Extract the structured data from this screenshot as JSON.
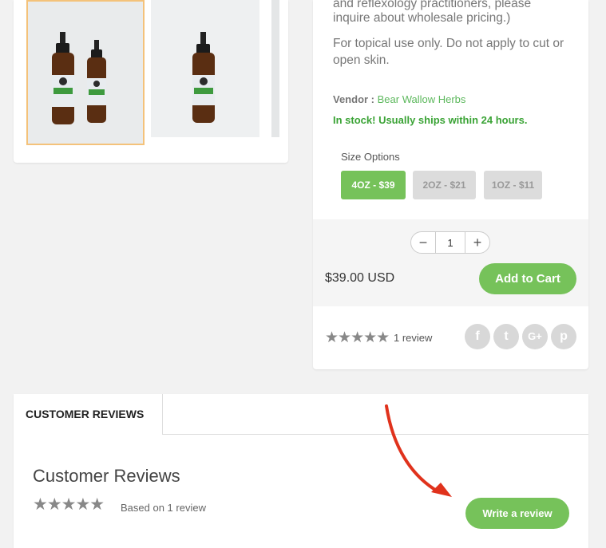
{
  "description": {
    "line1": "and reflexology practitioners, please",
    "line2": "inquire about wholesale pricing.)",
    "topical_line1": "For topical use only. Do not apply to cut or",
    "topical_line2": "open skin."
  },
  "vendor": {
    "label": "Vendor :",
    "name": "Bear Wallow Herbs"
  },
  "stock_text": "In stock! Usually ships within 24 hours.",
  "size_options": {
    "label": "Size Options",
    "options": [
      "4OZ - $39",
      "2OZ - $21",
      "1OZ - $11"
    ],
    "selected": "4OZ - $39"
  },
  "quantity": {
    "minus": "−",
    "value": "1",
    "plus": "+"
  },
  "price": "$39.00 USD",
  "add_to_cart": "Add to Cart",
  "rating": {
    "stars": "★★★★★",
    "count_text": "1 review"
  },
  "social": {
    "facebook": "f",
    "twitter": "t",
    "googleplus": "G+",
    "pinterest": "p"
  },
  "reviews": {
    "tab_label": "CUSTOMER REVIEWS",
    "title": "Customer Reviews",
    "stars": "★★★★★",
    "based_on": "Based on 1 review",
    "write_button": "Write a review"
  },
  "colors": {
    "accent_green": "#76c25a",
    "stock_green": "#3aa335",
    "vendor_link": "#5cb85c",
    "arrow_red": "#e0321c",
    "thumb_selected_border": "#f4c27a"
  }
}
